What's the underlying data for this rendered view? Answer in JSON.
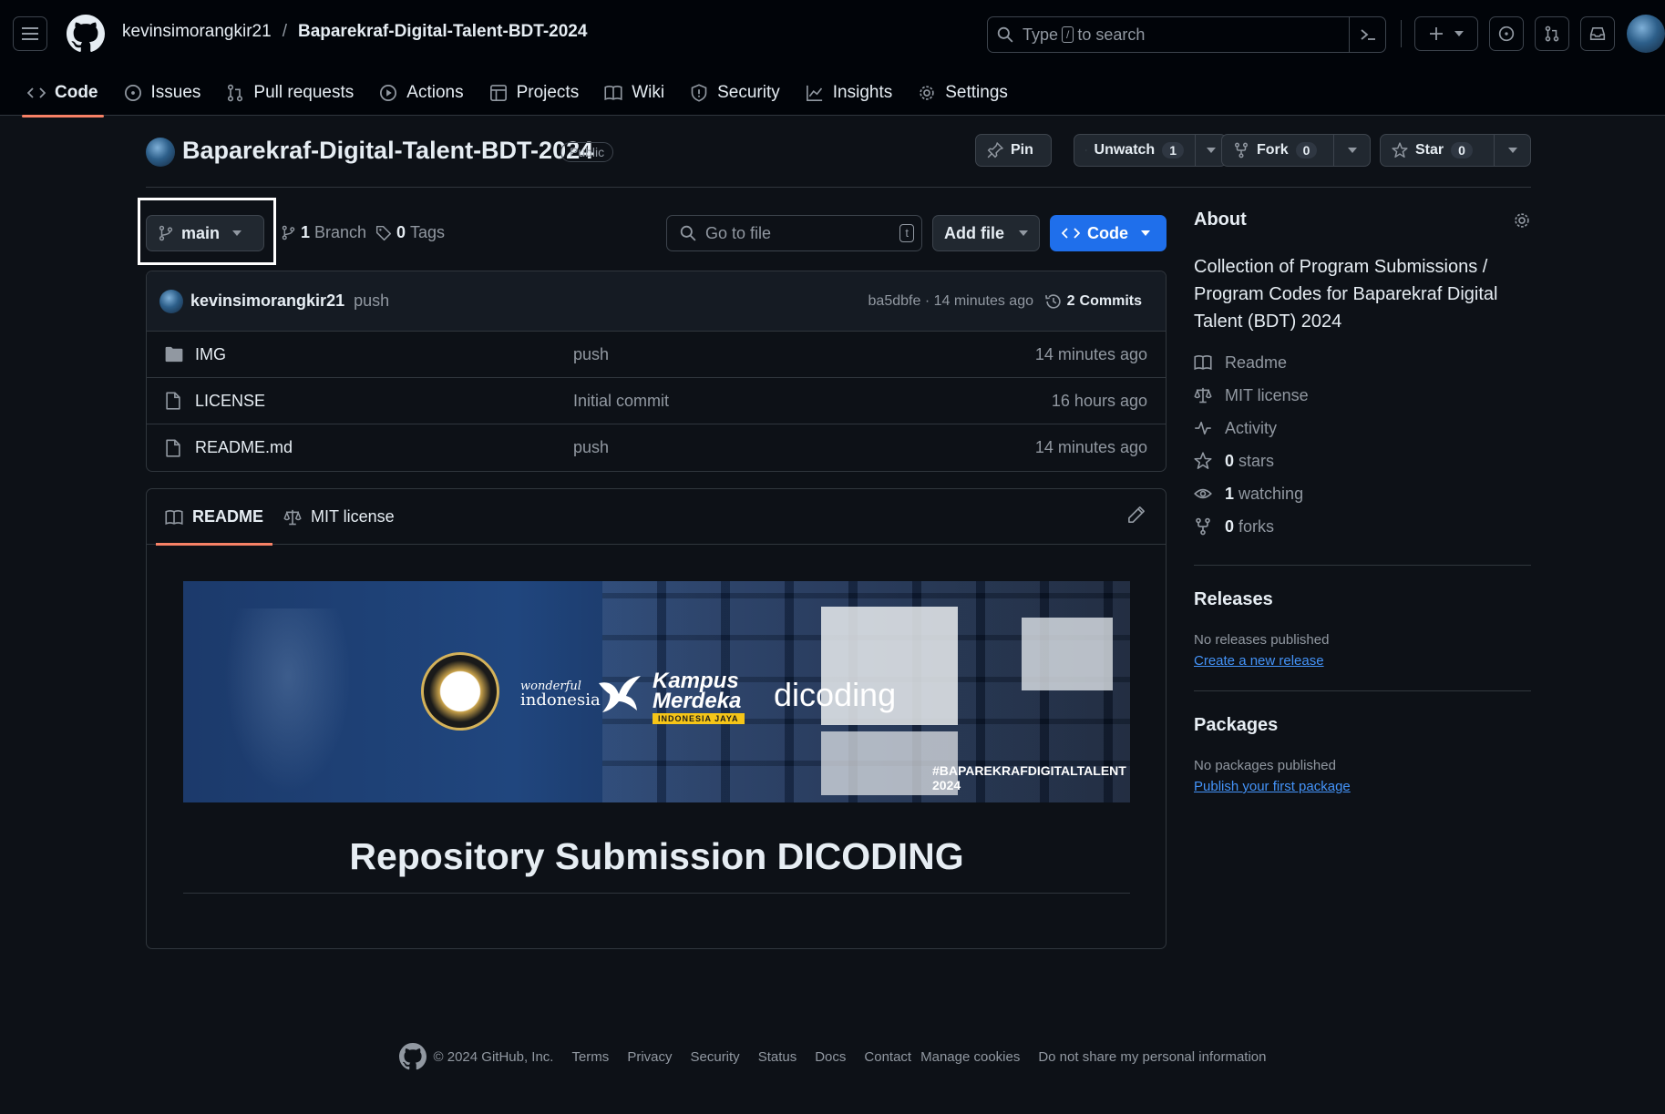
{
  "header": {
    "owner": "kevinsimorangkir21",
    "separator": "/",
    "repo": "Baparekraf-Digital-Talent-BDT-2024",
    "search_prefix": "Type",
    "search_key": "/",
    "search_suffix": "to search"
  },
  "nav_tabs": [
    {
      "label": "Code",
      "icon": "code-icon"
    },
    {
      "label": "Issues",
      "icon": "issue-icon"
    },
    {
      "label": "Pull requests",
      "icon": "pull-request-icon"
    },
    {
      "label": "Actions",
      "icon": "play-icon"
    },
    {
      "label": "Projects",
      "icon": "table-icon"
    },
    {
      "label": "Wiki",
      "icon": "book-icon"
    },
    {
      "label": "Security",
      "icon": "shield-icon"
    },
    {
      "label": "Insights",
      "icon": "graph-icon"
    },
    {
      "label": "Settings",
      "icon": "gear-icon"
    }
  ],
  "repo_header": {
    "title": "Baparekraf-Digital-Talent-BDT-2024",
    "visibility": "Public",
    "pin_label": "Pin",
    "watch_label": "Unwatch",
    "watch_count": "1",
    "fork_label": "Fork",
    "fork_count": "0",
    "star_label": "Star",
    "star_count": "0"
  },
  "toolbar": {
    "branch": "main",
    "branch_count": "1",
    "branch_label": "Branch",
    "tag_count": "0",
    "tag_label": "Tags",
    "goto_placeholder": "Go to file",
    "goto_key": "t",
    "add_file": "Add file",
    "code_button": "Code"
  },
  "commit": {
    "author": "kevinsimorangkir21",
    "message": "push",
    "hash_time": "ba5dbfe · 14 minutes ago",
    "commits_count": "2",
    "commits_label": "Commits"
  },
  "files": [
    {
      "name": "IMG",
      "type": "folder",
      "message": "push",
      "time": "14 minutes ago"
    },
    {
      "name": "LICENSE",
      "type": "file",
      "message": "Initial commit",
      "time": "16 hours ago"
    },
    {
      "name": "README.md",
      "type": "file",
      "message": "push",
      "time": "14 minutes ago"
    }
  ],
  "readme": {
    "tab_readme": "README",
    "tab_license": "MIT license",
    "heading": "Repository Submission DICODING",
    "banner": {
      "wonderful": "wonderful",
      "indonesia": "indonesia",
      "kampus": "Kampus",
      "merdeka": "Merdeka",
      "indonesia_jaya": "INDONESIA JAYA",
      "dicoding": "dicoding",
      "hashtag": "#BAPAREKRAFDIGITALTALENT 2024"
    }
  },
  "about": {
    "heading": "About",
    "description": "Collection of Program Submissions / Program Codes for Baparekraf Digital Talent (BDT) 2024",
    "readme": "Readme",
    "license": "MIT license",
    "activity": "Activity",
    "stars_count": "0",
    "stars_label": "stars",
    "watching_count": "1",
    "watching_label": "watching",
    "forks_count": "0",
    "forks_label": "forks"
  },
  "releases": {
    "heading": "Releases",
    "empty": "No releases published",
    "link": "Create a new release"
  },
  "packages": {
    "heading": "Packages",
    "empty": "No packages published",
    "link": "Publish your first package"
  },
  "footer": {
    "copyright": "© 2024 GitHub, Inc.",
    "links": [
      "Terms",
      "Privacy",
      "Security",
      "Status",
      "Docs",
      "Contact",
      "Manage cookies",
      "Do not share my personal information"
    ]
  },
  "colors": {
    "accent_blue": "#1f6feb",
    "tab_underline": "#f78166",
    "link": "#4493f8"
  }
}
